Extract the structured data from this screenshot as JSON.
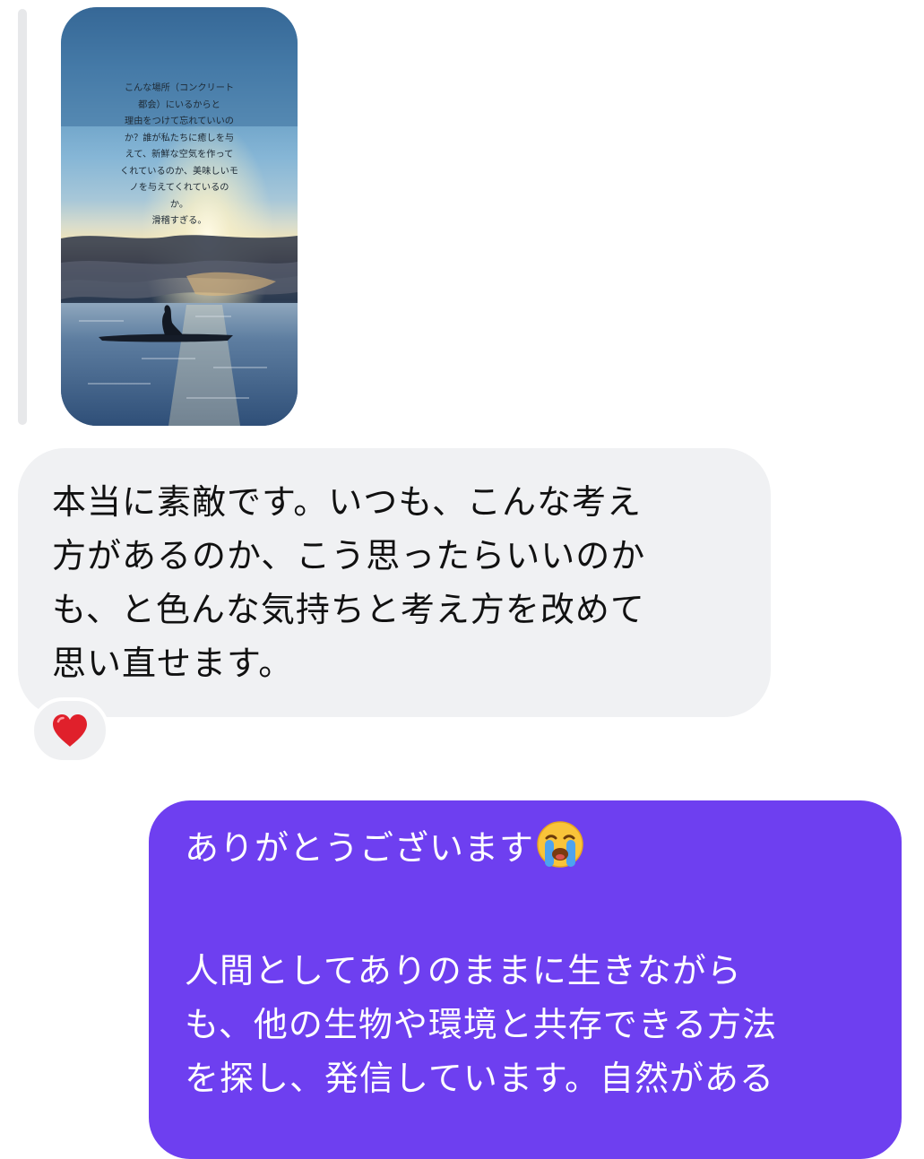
{
  "story": {
    "caption": "こんな場所（コンクリート\n都会）にいるからと\n理由をつけて忘れていいの\nか？誰が私たちに癒しを与\nえて、新鮮な空気を作って\nくれているのか、美味しいモ\nノを与えてくれているの\nか。\n滑稽すぎる。"
  },
  "incoming_message": {
    "text": "本当に素敵です。いつも、こんな考え\n方があるのか、こう思ったらいいのか\nも、と色んな気持ちと考え方を改めて\n思い直せます。",
    "reaction": "heart-reaction",
    "bubble_color": "#f0f1f3"
  },
  "outgoing_message": {
    "line1": "ありがとうございます",
    "emoji": "loudly-crying-face-emoji",
    "body": "人間としてありのままに生きながら\nも、他の生物や環境と共存できる方法\nを探し、発信しています。自然がある",
    "bubble_color": "#6e3ff0"
  }
}
